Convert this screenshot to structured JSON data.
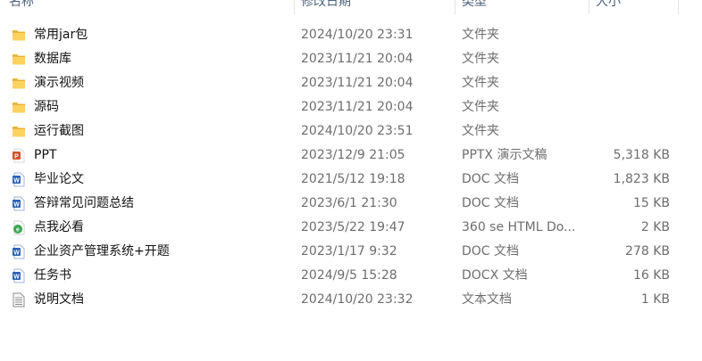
{
  "columns": {
    "name": "名称",
    "date": "修改日期",
    "type": "类型",
    "size": "大小"
  },
  "files": [
    {
      "name": "常用jar包",
      "date": "2024/10/20 23:31",
      "type": "文件夹",
      "size": "",
      "icon": "folder-icon"
    },
    {
      "name": "数据库",
      "date": "2023/11/21 20:04",
      "type": "文件夹",
      "size": "",
      "icon": "folder-icon"
    },
    {
      "name": "演示视频",
      "date": "2023/11/21 20:04",
      "type": "文件夹",
      "size": "",
      "icon": "folder-icon"
    },
    {
      "name": "源码",
      "date": "2023/11/21 20:04",
      "type": "文件夹",
      "size": "",
      "icon": "folder-icon"
    },
    {
      "name": "运行截图",
      "date": "2024/10/20 23:51",
      "type": "文件夹",
      "size": "",
      "icon": "folder-icon"
    },
    {
      "name": "PPT",
      "date": "2023/12/9 21:05",
      "type": "PPTX 演示文稿",
      "size": "5,318 KB",
      "icon": "pptx-file-icon"
    },
    {
      "name": "毕业论文",
      "date": "2021/5/12 19:18",
      "type": "DOC 文档",
      "size": "1,823 KB",
      "icon": "doc-file-icon"
    },
    {
      "name": "答辩常见问题总结",
      "date": "2023/6/1 21:30",
      "type": "DOC 文档",
      "size": "15 KB",
      "icon": "doc-file-icon"
    },
    {
      "name": "点我必看",
      "date": "2023/5/22 19:47",
      "type": "360 se HTML Do...",
      "size": "2 KB",
      "icon": "html-file-icon"
    },
    {
      "name": "企业资产管理系统+开题",
      "date": "2023/1/17 9:32",
      "type": "DOC 文档",
      "size": "278 KB",
      "icon": "doc-file-icon"
    },
    {
      "name": "任务书",
      "date": "2024/9/5 15:28",
      "type": "DOCX 文档",
      "size": "16 KB",
      "icon": "docx-file-icon"
    },
    {
      "name": "说明文档",
      "date": "2024/10/20 23:32",
      "type": "文本文档",
      "size": "1 KB",
      "icon": "txt-file-icon"
    }
  ]
}
